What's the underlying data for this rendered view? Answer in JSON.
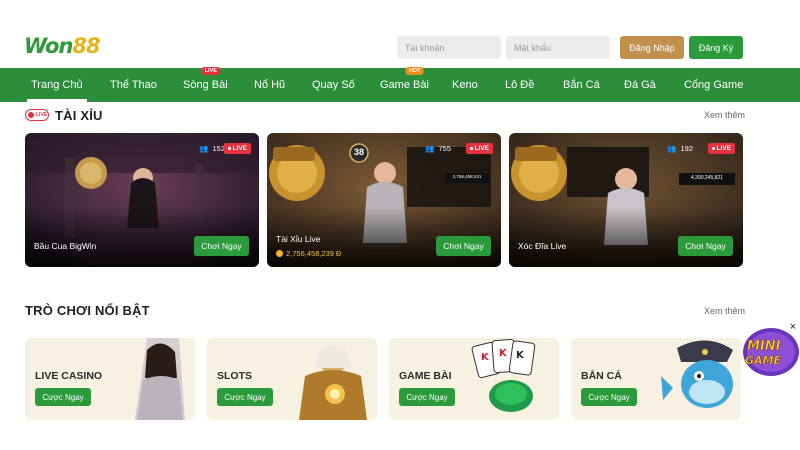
{
  "brand": {
    "logo_text_a": "Won",
    "logo_text_b": "88"
  },
  "auth": {
    "username_placeholder": "Tài khoản",
    "password_placeholder": "Mật khẩu",
    "login_label": "Đăng Nhập",
    "register_label": "Đăng Ký"
  },
  "nav": {
    "items": [
      {
        "label": "Trang Chủ",
        "active": true
      },
      {
        "label": "Thể Thao"
      },
      {
        "label": "Sòng Bài",
        "badge": "LIVE"
      },
      {
        "label": "Nổ Hũ"
      },
      {
        "label": "Quay Số"
      },
      {
        "label": "Game Bài",
        "badge": "HOT"
      },
      {
        "label": "Keno"
      },
      {
        "label": "Lô Đề"
      },
      {
        "label": "Bắn Cá"
      },
      {
        "label": "Đá Gà"
      },
      {
        "label": "Cổng Game"
      }
    ]
  },
  "live_section": {
    "live_icon_text": "LIVE",
    "title": "TÀI XỈU",
    "more_label": "Xem thêm",
    "cards": [
      {
        "name": "Bầu Cua BigWin",
        "viewers": "152",
        "live": "LIVE",
        "play": "Chơi Ngay"
      },
      {
        "name": "Tài Xỉu Live",
        "viewers": "755",
        "live": "LIVE",
        "play": "Chơi Ngay",
        "jackpot": "2,756,458,239 Đ",
        "timer": "38",
        "screen_value": "2,756,458,241"
      },
      {
        "name": "Xóc Đĩa Live",
        "viewers": "192",
        "live": "LIVE",
        "play": "Chơi Ngay",
        "screen_value": "4,390,245,821"
      }
    ]
  },
  "featured_section": {
    "title": "TRÒ CHƠI NỔI BẬT",
    "more_label": "Xem thêm",
    "items": [
      {
        "label": "LIVE CASINO",
        "button": "Cược Ngay"
      },
      {
        "label": "SLOTS",
        "button": "Cược Ngay"
      },
      {
        "label": "GAME BÀI",
        "button": "Cược Ngay"
      },
      {
        "label": "BẮN CÁ",
        "button": "Cược Ngay"
      }
    ]
  },
  "floating": {
    "mini_game_label": "MINI GAME",
    "close_glyph": "×"
  },
  "colors": {
    "primary_green": "#2a8e3a",
    "gold": "#c2904d",
    "live_red": "#e53140",
    "hot_orange": "#f08a1c"
  }
}
